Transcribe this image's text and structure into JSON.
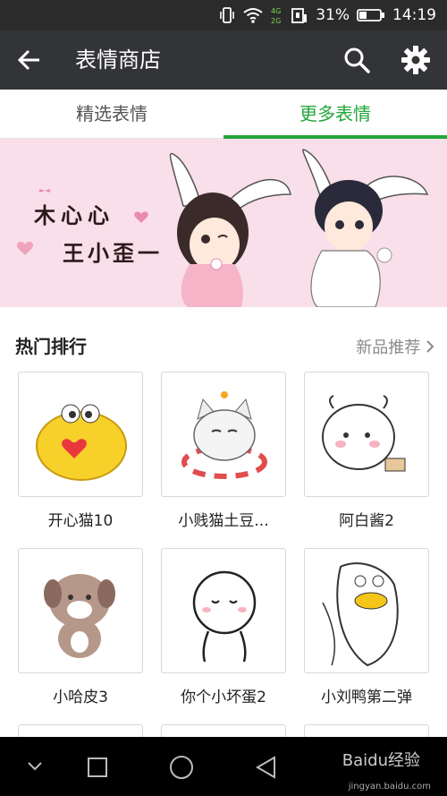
{
  "status_bar": {
    "battery_percent": "31%",
    "time": "14:19",
    "icons": [
      "vibrate-icon",
      "wifi-icon",
      "signal-4g-icon",
      "sim-icon",
      "battery-icon"
    ]
  },
  "app_bar": {
    "title": "表情商店",
    "icons": [
      "back-arrow-icon",
      "search-icon",
      "gear-icon"
    ]
  },
  "tabs": [
    {
      "label": "精选表情",
      "active": false
    },
    {
      "label": "更多表情",
      "active": true
    }
  ],
  "banner": {
    "line1": "木心心",
    "line2": "王小歪一"
  },
  "section": {
    "title": "热门排行",
    "more": "新品推荐",
    "more_icon": "chevron-right-icon"
  },
  "items": [
    {
      "name": "开心猫10"
    },
    {
      "name": "小贱猫土豆..."
    },
    {
      "name": "阿白酱2"
    },
    {
      "name": "小哈皮3"
    },
    {
      "name": "你个小坏蛋2"
    },
    {
      "name": "小刘鸭第二弹"
    }
  ],
  "nav_bar": {
    "icons": [
      "collapse-icon",
      "recents-icon",
      "home-icon",
      "back-icon"
    ],
    "watermark": "Baidu经验",
    "watermark_sub": "jingyan.baidu.com"
  },
  "colors": {
    "accent": "#22a73a",
    "app_bar": "#333438",
    "banner_bg": "#f9dfe9"
  }
}
